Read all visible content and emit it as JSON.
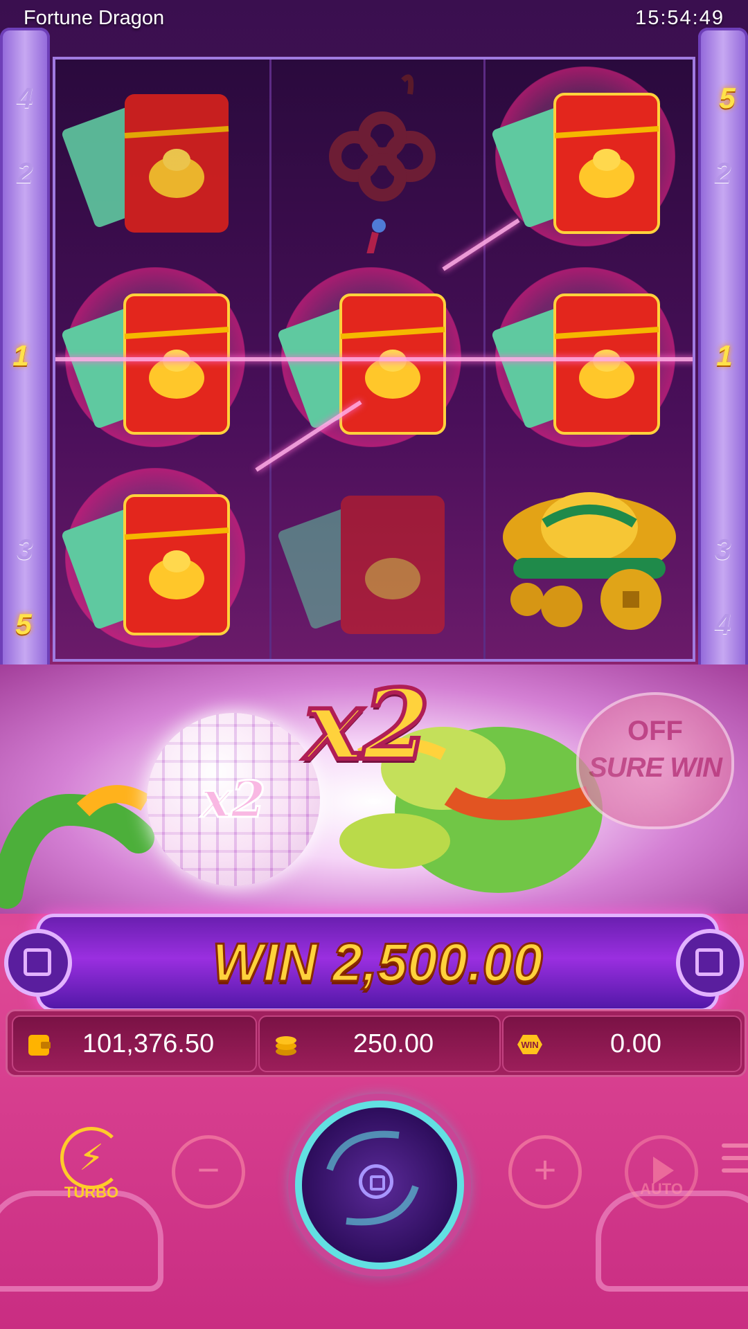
{
  "app": {
    "title": "Fortune Dragon",
    "clock": "15:54:49"
  },
  "line_numbers": {
    "left": [
      "4",
      "2",
      "1",
      "3",
      "5"
    ],
    "right": [
      "5",
      "2",
      "1",
      "3",
      "4"
    ],
    "active": [
      "1",
      "5"
    ]
  },
  "reels": [
    [
      "red-envelope-icon",
      "red-envelope-icon",
      "red-envelope-icon"
    ],
    [
      "chinese-knot-icon",
      "red-envelope-icon",
      "red-envelope-icon"
    ],
    [
      "red-envelope-icon",
      "red-envelope-icon",
      "gold-ingot-icon"
    ]
  ],
  "scene": {
    "multiplier": "x2",
    "disco_multiplier": "x2",
    "sure_win_state": "OFF",
    "sure_win_label": "SURE WIN"
  },
  "win_bar": {
    "text": "WIN 2,500.00"
  },
  "info": {
    "balance": "101,376.50",
    "bet": "250.00",
    "win": "0.00"
  },
  "controls": {
    "turbo_label": "TURBO",
    "auto_label": "AUTO",
    "minus": "−",
    "plus": "+"
  },
  "colors": {
    "accent_gold": "#ffd23c",
    "spin_ring": "#62e0e2",
    "panel_pink": "#c92d82"
  }
}
